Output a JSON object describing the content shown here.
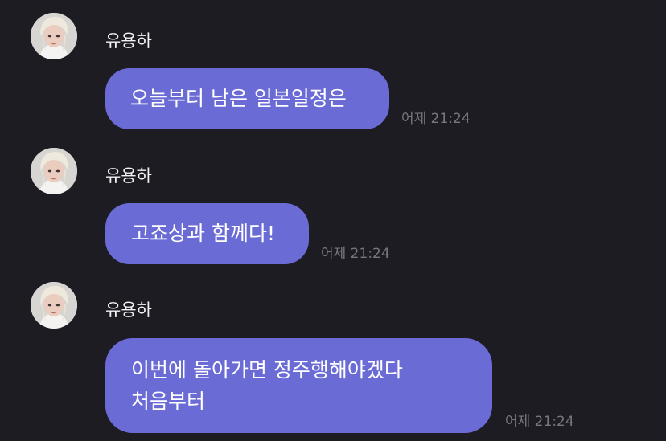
{
  "chat": {
    "messages": [
      {
        "sender": "유용하",
        "text": "오늘부터 남은 일본일정은",
        "time": "어제 21:24",
        "avatar_icon": "profile-photo"
      },
      {
        "sender": "유용하",
        "text": "고죠상과 함께다!",
        "time": "어제 21:24",
        "avatar_icon": "profile-photo"
      },
      {
        "sender": "유용하",
        "text": "이번에 돌아가면 정주행해야겠다 처음부터",
        "time": "어제 21:24",
        "avatar_icon": "profile-photo"
      }
    ]
  },
  "colors": {
    "background": "#1c1c22",
    "bubble": "#6b6bd6",
    "sender_text": "#f2f2f5",
    "time_text": "#77777f"
  }
}
